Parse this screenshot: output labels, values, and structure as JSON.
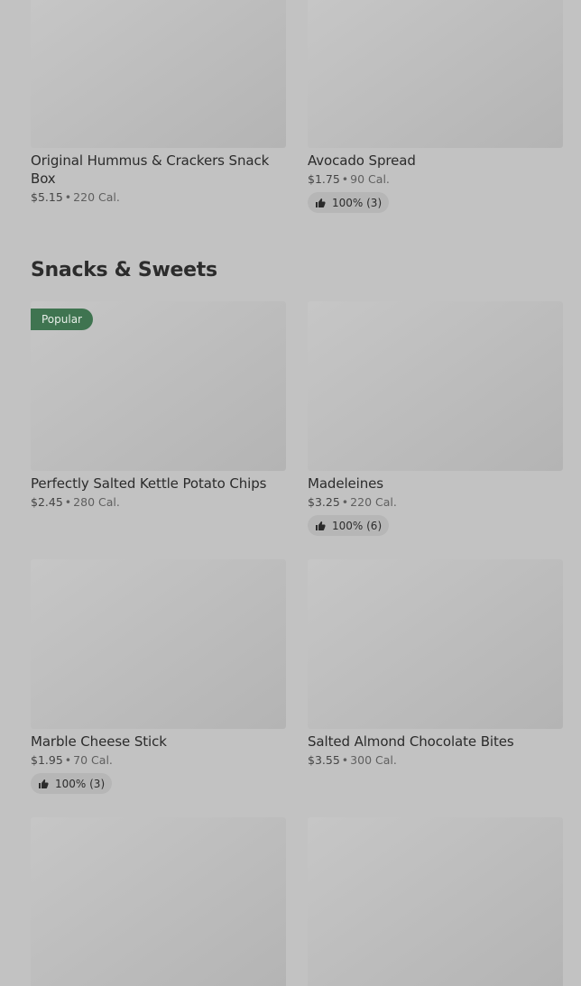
{
  "section": {
    "title": "Snacks & Sweets"
  },
  "badges": {
    "popular": "Popular"
  },
  "items": [
    {
      "name": "Original Hummus & Crackers Snack Box",
      "price": "$5.15",
      "calories": "220 Cal."
    },
    {
      "name": "Avocado Spread",
      "price": "$1.75",
      "calories": "90 Cal.",
      "rating": "100% (3)"
    },
    {
      "name": "Perfectly Salted Kettle Potato Chips",
      "price": "$2.45",
      "calories": "280 Cal.",
      "badge": "Popular"
    },
    {
      "name": "Madeleines",
      "price": "$3.25",
      "calories": "220 Cal.",
      "rating": "100% (6)"
    },
    {
      "name": "Marble Cheese Stick",
      "price": "$1.95",
      "calories": "70 Cal.",
      "rating": "100% (3)"
    },
    {
      "name": "Salted Almond Chocolate Bites",
      "price": "$3.55",
      "calories": "300 Cal."
    }
  ],
  "separator": "•",
  "icons": {
    "rating": "thumbs-up-icon"
  },
  "colors": {
    "badge_bg": "#3f7450",
    "overlay_bg": "#c2c2c2"
  }
}
